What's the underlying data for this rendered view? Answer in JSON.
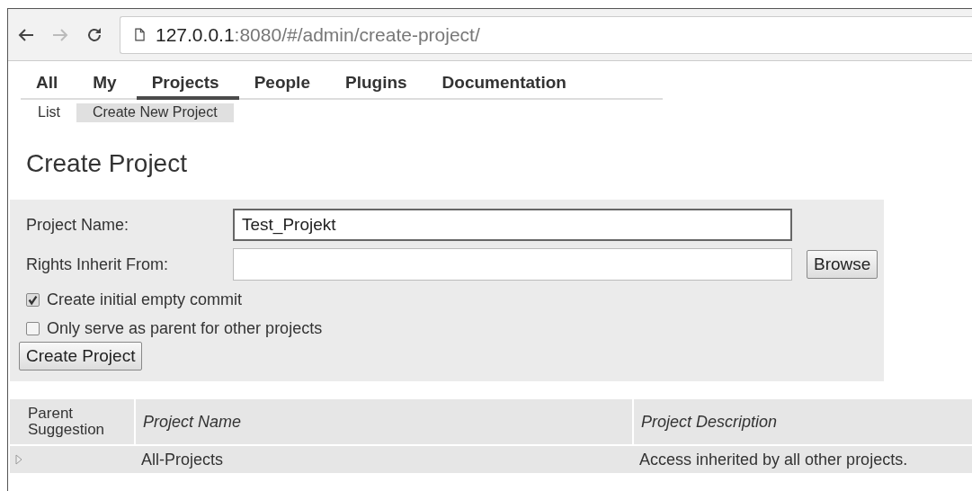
{
  "browser": {
    "url_host": "127.0.0.1",
    "url_rest": ":8080/#/admin/create-project/"
  },
  "nav_tabs": [
    {
      "label": "All",
      "selected": false
    },
    {
      "label": "My",
      "selected": false
    },
    {
      "label": "Projects",
      "selected": true
    },
    {
      "label": "People",
      "selected": false
    },
    {
      "label": "Plugins",
      "selected": false
    },
    {
      "label": "Documentation",
      "selected": false
    }
  ],
  "sub_tabs": [
    {
      "label": "List",
      "selected": false
    },
    {
      "label": "Create New Project",
      "selected": true
    }
  ],
  "heading": "Create Project",
  "form": {
    "fields": [
      {
        "label": "Project Name:",
        "value": "Test_Projekt",
        "focused": true
      },
      {
        "label": "Rights Inherit From:",
        "button": "Browse",
        "focused": false
      }
    ],
    "checkboxes": [
      {
        "label": "Create initial empty commit",
        "checked": true
      },
      {
        "label": "Only serve as parent for other projects",
        "checked": false
      }
    ],
    "submit": "Create Project"
  },
  "table": {
    "columns": [
      {
        "label": "Parent Suggestion",
        "italic": false
      },
      {
        "label": "Project Name",
        "italic": true
      },
      {
        "label": "Project Description",
        "italic": true
      }
    ],
    "rows": [
      {
        "name": "All-Projects",
        "description": "Access inherited by all other projects."
      }
    ]
  }
}
